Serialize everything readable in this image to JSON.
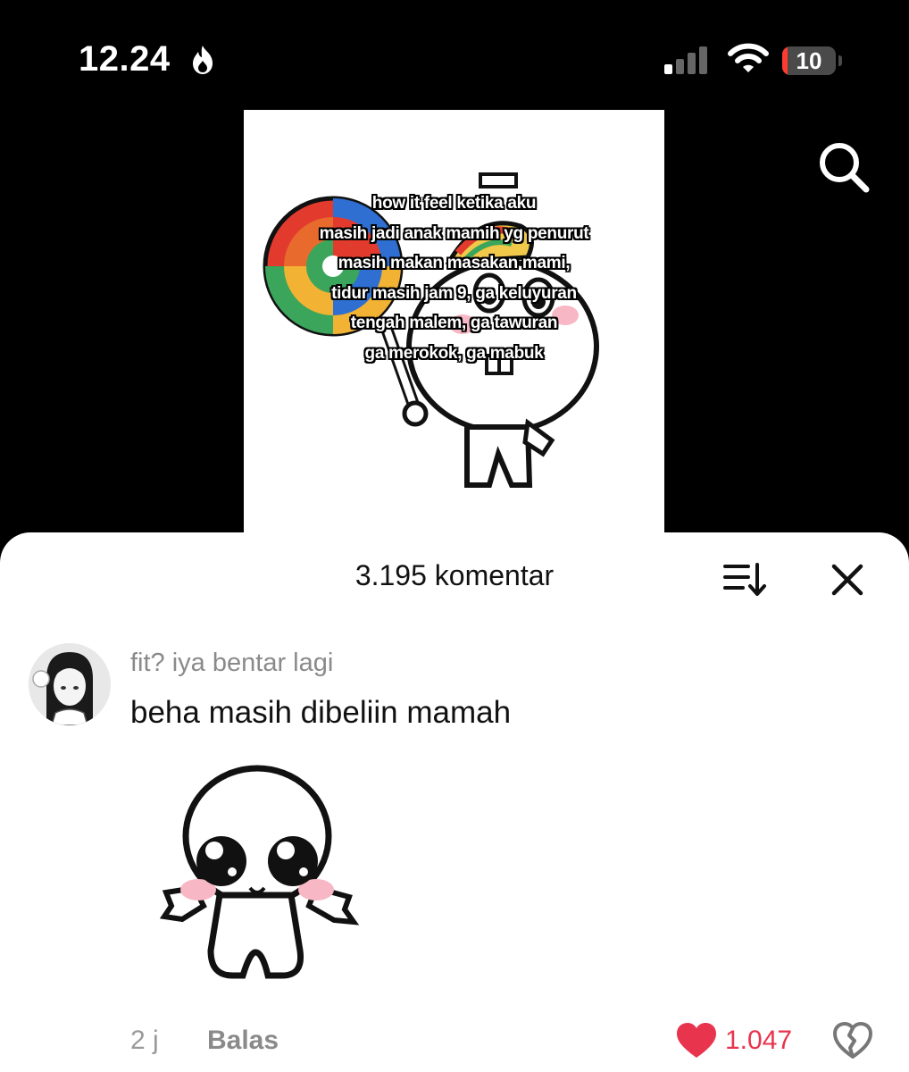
{
  "status_bar": {
    "time": "12.24",
    "battery_level": "10",
    "icons": [
      "flame-icon",
      "signal-icon",
      "wifi-icon",
      "battery-icon"
    ]
  },
  "header": {
    "search_icon": "search-icon"
  },
  "video": {
    "caption_lines": [
      "how it feel ketika aku",
      "masih jadi anak mamih yg penurut",
      "masih makan masakan mami,",
      "tidur masih jam 9, ga keluyuran",
      "tengah malem, ga tawuran",
      "ga merokok, ga mabuk"
    ]
  },
  "comments_sheet": {
    "title": "3.195 komentar",
    "sort_icon": "sort-icon",
    "close_icon": "close-icon",
    "comment": {
      "username": "fit? iya bentar lagi",
      "text": "beha masih dibeliin mamah",
      "timestamp": "2 j",
      "reply_label": "Balas",
      "like_count": "1.047",
      "like_color": "#e8344d"
    }
  }
}
